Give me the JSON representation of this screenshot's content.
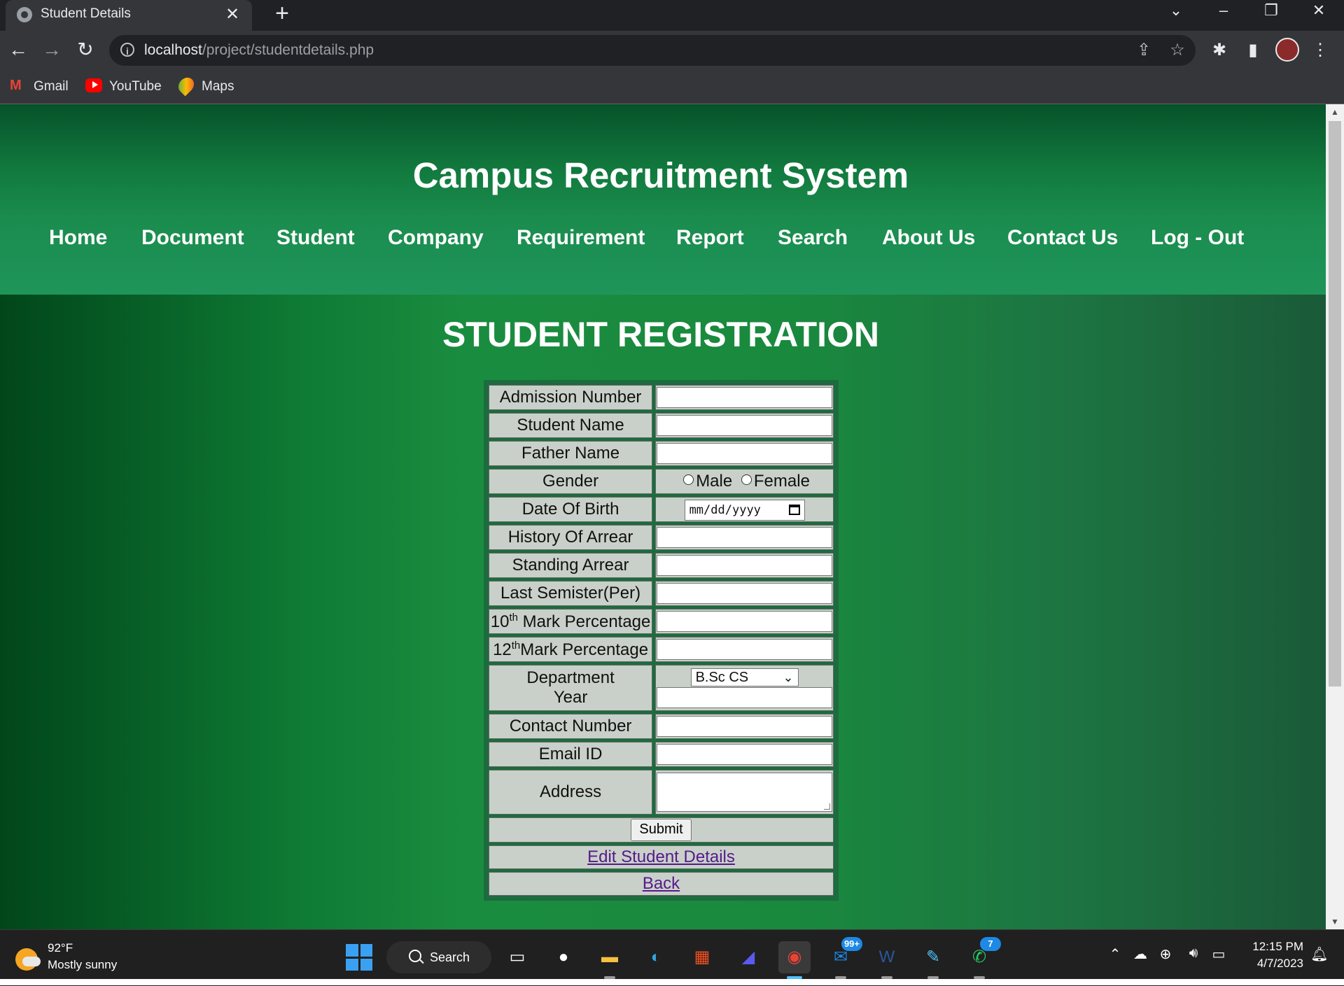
{
  "browser": {
    "tab_title": "Student Details",
    "new_tab": "+",
    "url_host": "localhost",
    "url_path": "/project/studentdetails.php",
    "bookmarks": [
      "Gmail",
      "YouTube",
      "Maps"
    ]
  },
  "page": {
    "site_title": "Campus Recruitment System",
    "nav": [
      "Home",
      "Document",
      "Student",
      "Company",
      "Requirement",
      "Report",
      "Search",
      "About Us",
      "Contact Us",
      "Log - Out"
    ],
    "heading": "STUDENT REGISTRATION",
    "form": {
      "admission_number": "Admission Number",
      "student_name": "Student Name",
      "father_name": "Father Name",
      "gender": "Gender",
      "gender_male": "Male",
      "gender_female": "Female",
      "dob": "Date Of Birth",
      "dob_placeholder": "mm/dd/yyyy",
      "history_arrear": "History Of Arrear",
      "standing_arrear": "Standing Arrear",
      "last_semester": "Last Semister(Per)",
      "tenth_num": "10",
      "tenth_sup": "th",
      "tenth_rest": " Mark Percentage",
      "twelfth_num": "12",
      "twelfth_sup": "th",
      "twelfth_rest": "Mark Percentage",
      "department": "Department",
      "year": "Year",
      "department_selected": "B.Sc CS",
      "contact_number": "Contact Number",
      "email_id": "Email ID",
      "address": "Address",
      "submit": "Submit",
      "edit_link": "Edit Student Details",
      "back_link": "Back"
    }
  },
  "taskbar": {
    "weather_temp": "92°F",
    "weather_desc": "Mostly sunny",
    "search_label": "Search",
    "mail_badge": "99+",
    "whatsapp_badge": "7",
    "time": "12:15 PM",
    "date": "4/7/2023"
  }
}
